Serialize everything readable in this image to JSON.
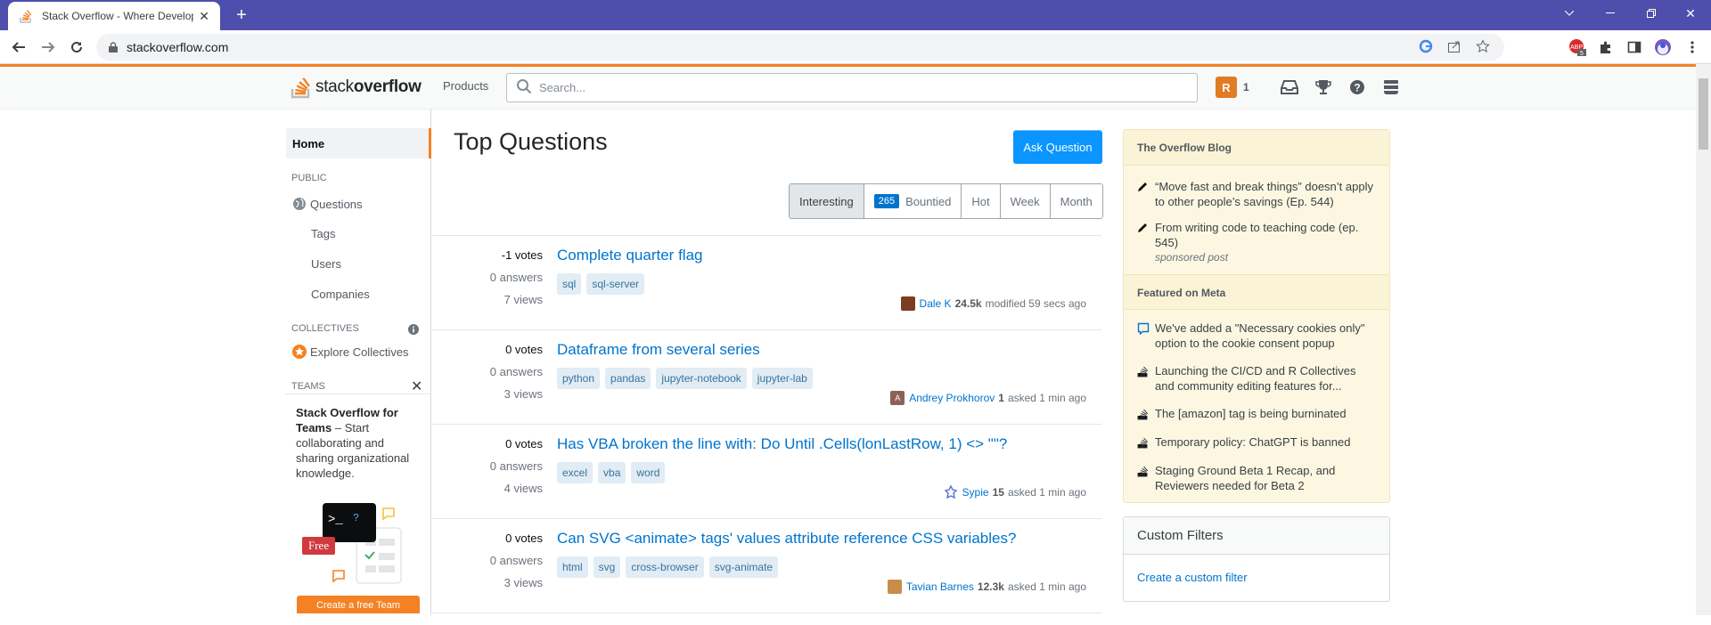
{
  "browser": {
    "tab_title": "Stack Overflow - Where Developers Learn, Share, & Build Careers",
    "url": "stackoverflow.com"
  },
  "header": {
    "logo_light": "stack",
    "logo_bold": "overflow",
    "products": "Products",
    "search_placeholder": "Search...",
    "avatar_letter": "R",
    "reputation": "1"
  },
  "sidebar": {
    "home": "Home",
    "public_label": "PUBLIC",
    "questions": "Questions",
    "tags": "Tags",
    "users": "Users",
    "companies": "Companies",
    "collectives_label": "COLLECTIVES",
    "explore_collectives": "Explore Collectives",
    "teams_label": "TEAMS",
    "teams_title": "Stack Overflow for Teams",
    "teams_desc": " – Start collaborating and sharing organizational knowledge.",
    "free_badge": "Free",
    "create_team": "Create a free Team"
  },
  "main": {
    "title": "Top Questions",
    "ask_button": "Ask Question",
    "filters": {
      "interesting": "Interesting",
      "bountied_count": "265",
      "bountied": "Bountied",
      "hot": "Hot",
      "week": "Week",
      "month": "Month"
    },
    "questions": [
      {
        "votes": "-1 votes",
        "answers": "0 answers",
        "views": "7 views",
        "title": "Complete quarter flag",
        "tags": [
          "sql",
          "sql-server"
        ],
        "user": "Dale K",
        "rep": "24.5k",
        "action": "modified 59 secs ago",
        "avatar_color": "#7a3d22"
      },
      {
        "votes": "0 votes",
        "answers": "0 answers",
        "views": "3 views",
        "title": "Dataframe from several series",
        "tags": [
          "python",
          "pandas",
          "jupyter-notebook",
          "jupyter-lab"
        ],
        "user": "Andrey Prokhorov",
        "rep": "1",
        "action": "asked 1 min ago",
        "avatar_color": "#8b6356",
        "avatar_letter": "A"
      },
      {
        "votes": "0 votes",
        "answers": "0 answers",
        "views": "4 views",
        "title": "Has VBA broken the line with: Do Until .Cells(lonLastRow, 1) <> \"\"?",
        "tags": [
          "excel",
          "vba",
          "word"
        ],
        "user": "Sypie",
        "rep": "15",
        "action": "asked 1 min ago",
        "avatar_color": "#5b6fd6"
      },
      {
        "votes": "0 votes",
        "answers": "0 answers",
        "views": "3 views",
        "title": "Can SVG <animate> tags' values attribute reference CSS variables?",
        "tags": [
          "html",
          "svg",
          "cross-browser",
          "svg-animate"
        ],
        "user": "Tavian Barnes",
        "rep": "12.3k",
        "action": "asked 1 min ago",
        "avatar_color": "#c98d4a"
      }
    ]
  },
  "right": {
    "blog_title": "The Overflow Blog",
    "blog_items": [
      "“Move fast and break things” doesn’t apply to other people’s savings (Ep. 544)",
      "From writing code to teaching code (ep. 545)"
    ],
    "sponsored": "sponsored post",
    "meta_title": "Featured on Meta",
    "meta_items": [
      "We've added a \"Necessary cookies only\" option to the cookie consent popup",
      "Launching the CI/CD and R Collectives and community editing features for...",
      "The [amazon] tag is being burninated",
      "Temporary policy: ChatGPT is banned",
      "Staging Ground Beta 1 Recap, and Reviewers needed for Beta 2"
    ],
    "custom_filters_title": "Custom Filters",
    "custom_filter_link": "Create a custom filter"
  },
  "colors": {
    "so_orange": "#f48225",
    "link_blue": "#0074cc",
    "button_blue": "#0a95ff",
    "tab_bar": "#4e4fac"
  }
}
